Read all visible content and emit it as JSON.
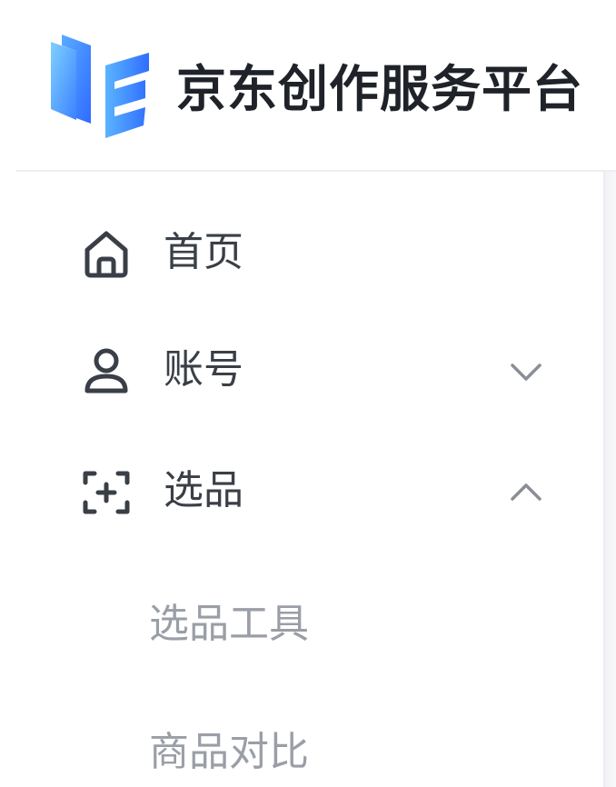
{
  "brand": {
    "title": "京东创作服务平台",
    "logo_icon": "jd-creator-logo-icon",
    "colors": {
      "logo_light": "#6fc7ff",
      "logo_dark": "#2f6dff"
    }
  },
  "sidebar": {
    "items": [
      {
        "label": "首页",
        "icon": "home-icon",
        "expandable": false
      },
      {
        "label": "账号",
        "icon": "user-icon",
        "expandable": true,
        "expanded": false
      },
      {
        "label": "选品",
        "icon": "scan-add-icon",
        "expandable": true,
        "expanded": true,
        "children": [
          {
            "label": "选品工具"
          },
          {
            "label": "商品对比"
          }
        ]
      }
    ],
    "colors": {
      "text_primary": "#3a3f47",
      "text_secondary": "#9a9ea6",
      "divider": "#eceef2"
    }
  }
}
